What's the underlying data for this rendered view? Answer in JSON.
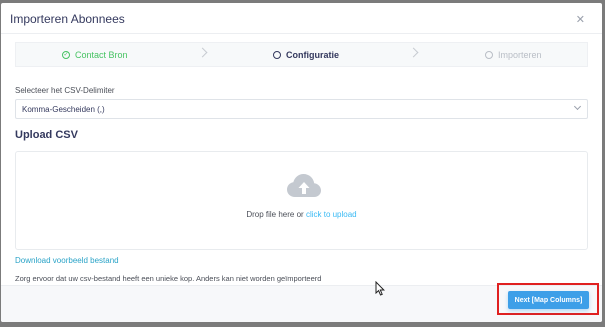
{
  "modal": {
    "title": "Importeren Abonnees",
    "close_icon": "close-icon"
  },
  "steps": [
    {
      "label": "Contact Bron",
      "state": "completed",
      "icon": "check-circle-icon"
    },
    {
      "label": "Configuratie",
      "state": "active",
      "icon": "circle-icon"
    },
    {
      "label": "Importeren",
      "state": "pending",
      "icon": "circle-icon"
    }
  ],
  "delimiter": {
    "label": "Selecteer het CSV-Delimiter",
    "value": "Komma-Gescheiden (,)"
  },
  "upload": {
    "title": "Upload CSV",
    "drop_text": "Drop file here or",
    "drop_link": "click to upload",
    "icon": "cloud-upload-icon"
  },
  "download_link": "Download voorbeeld bestand",
  "hint": "Zorg ervoor dat uw csv-bestand heeft een unieke kop. Anders kan niet worden geïmporteerd",
  "footer": {
    "next_label": "Next [Map Columns]"
  },
  "colors": {
    "completed": "#47c363",
    "primary": "#3d9fe8",
    "link": "#3abaf4",
    "highlight": "#e02020"
  }
}
